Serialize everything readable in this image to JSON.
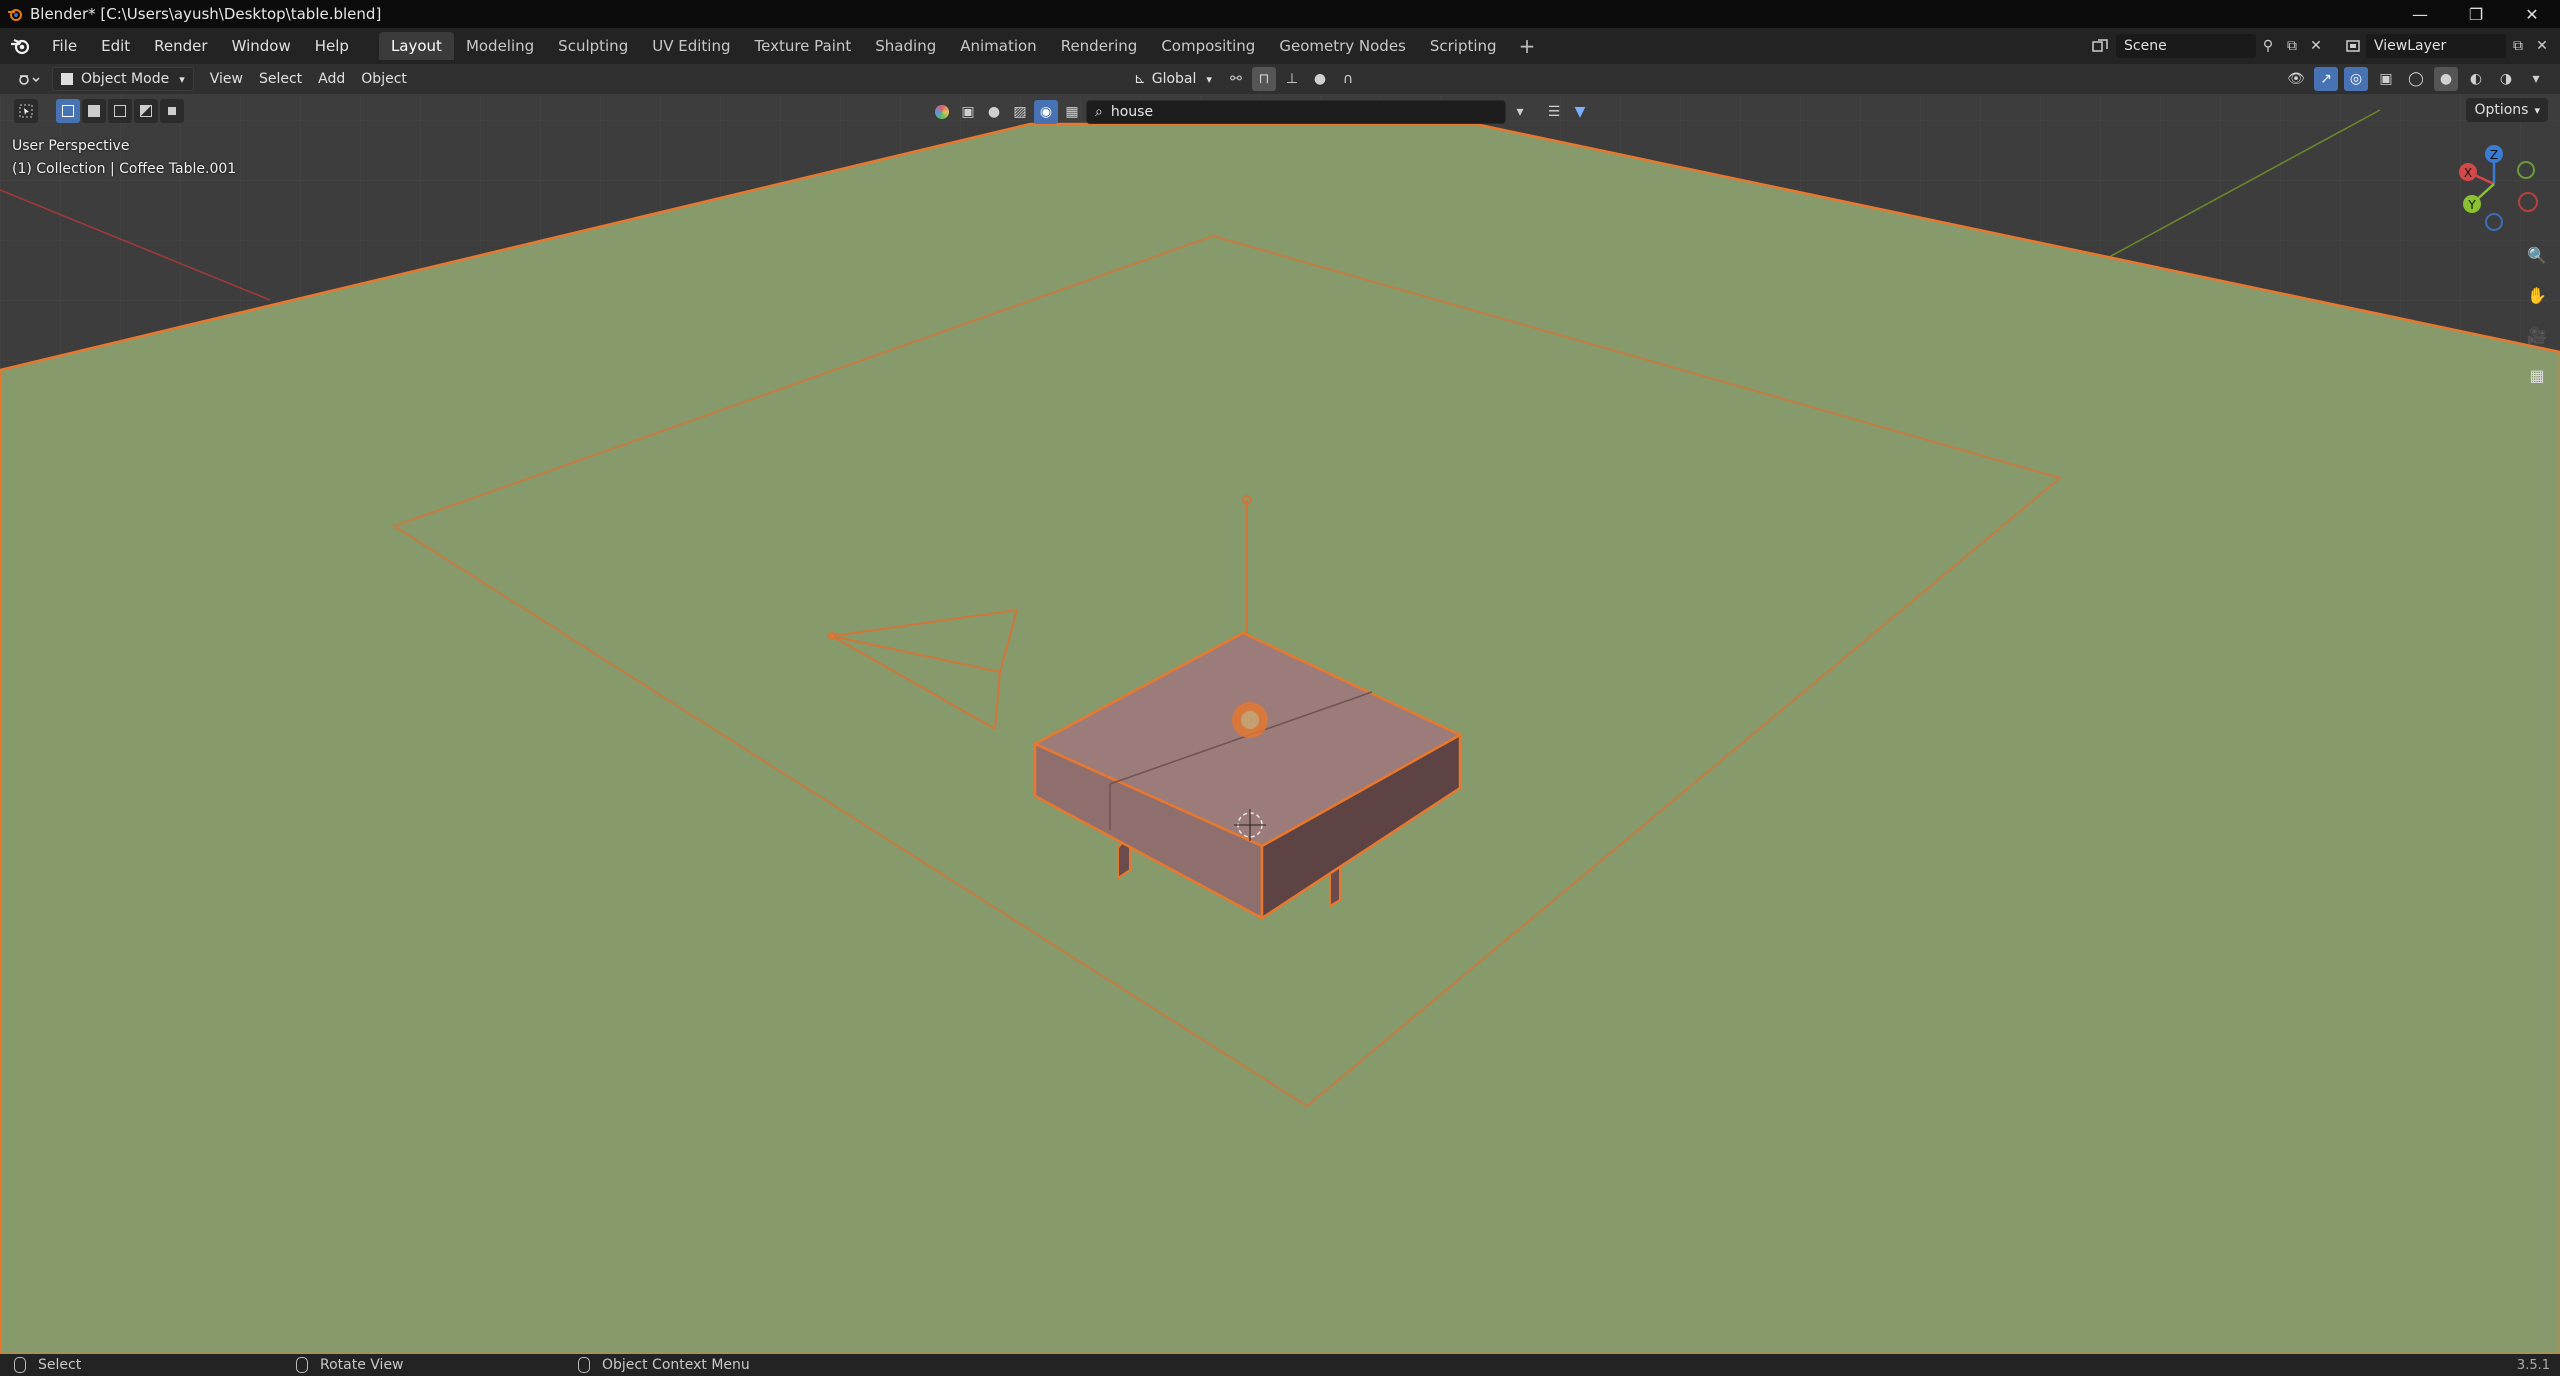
{
  "window": {
    "title": "Blender* [C:\\Users\\ayush\\Desktop\\table.blend]",
    "controls": [
      "—",
      "❐",
      "✕"
    ]
  },
  "menu": [
    "File",
    "Edit",
    "Render",
    "Window",
    "Help"
  ],
  "workspaces": {
    "tabs": [
      "Layout",
      "Modeling",
      "Sculpting",
      "UV Editing",
      "Texture Paint",
      "Shading",
      "Animation",
      "Rendering",
      "Compositing",
      "Geometry Nodes",
      "Scripting"
    ],
    "active": "Layout",
    "add_label": "+"
  },
  "scene": {
    "name": "Scene",
    "view_layer": "ViewLayer"
  },
  "header": {
    "mode": "Object Mode",
    "menus": [
      "View",
      "Select",
      "Add",
      "Object"
    ],
    "transform_orientation": "Global"
  },
  "search": {
    "value": "house"
  },
  "options_label": "Options",
  "viewport_info": {
    "view_name": "User Perspective",
    "collection": "(1) Collection | Coffee Table.001"
  },
  "gizmo": {
    "x": "X",
    "y": "Y",
    "z": "Z"
  },
  "status": {
    "select": "Select",
    "rotate": "Rotate View",
    "context": "Object Context Menu",
    "version": "3.5.1"
  },
  "colors": {
    "ground": "#879a6c",
    "selection_outline": "#e8782d",
    "table": "#9a7878",
    "active_tab": "#3b3b3b",
    "accent": "#4772b3"
  }
}
